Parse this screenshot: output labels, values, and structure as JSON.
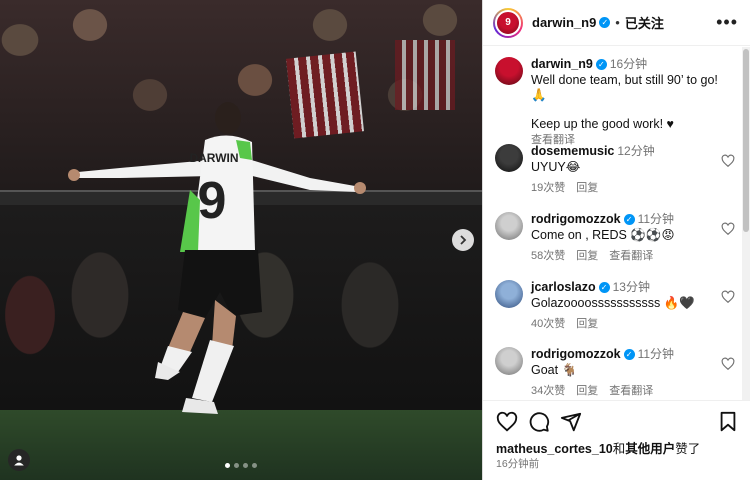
{
  "post": {
    "image_alt": "DARWIN 9",
    "jersey_name": "DARWIN",
    "jersey_number": "9",
    "carousel": {
      "count": 4,
      "active_index": 0
    }
  },
  "header": {
    "username": "darwin_n9",
    "separator": "•",
    "follow_status": "已关注",
    "more_icon": "more-horizontal-icon"
  },
  "caption": {
    "username": "darwin_n9",
    "time": "16分钟",
    "text_line1": "Well done team, but still 90’ to go! 🙏",
    "text_line2": "Keep up the good work! ♥",
    "translate": "查看翻译"
  },
  "comments": [
    {
      "username": "dosememusic",
      "verified": false,
      "time": "12分钟",
      "text": "UYUY😂",
      "likes": "19次赞",
      "reply": "回复",
      "translate": ""
    },
    {
      "username": "rodrigomozzok",
      "verified": true,
      "time": "11分钟",
      "text": "Come on , REDS ⚽⚽😡",
      "likes": "58次赞",
      "reply": "回复",
      "translate": "查看翻译"
    },
    {
      "username": "jcarloslazo",
      "verified": true,
      "time": "13分钟",
      "text": "Golazoooosssssssssss 🔥🖤",
      "likes": "40次赞",
      "reply": "回复",
      "translate": ""
    },
    {
      "username": "rodrigomozzok",
      "verified": true,
      "time": "11分钟",
      "text": "Goat 🐐",
      "likes": "34次赞",
      "reply": "回复",
      "translate": "查看翻译"
    }
  ],
  "footer": {
    "liked_by_user": "matheus_cortes_10",
    "liked_by_mid": "和",
    "liked_by_others": "其他用户",
    "liked_by_end": "赞了",
    "post_time": "16分钟前"
  }
}
